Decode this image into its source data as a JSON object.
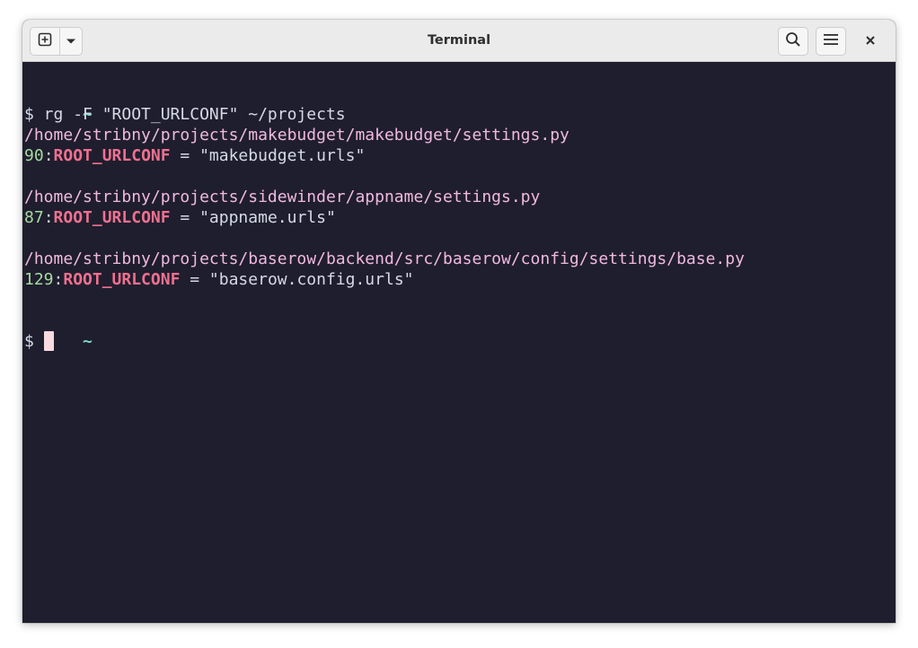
{
  "window": {
    "title": "Terminal"
  },
  "header": {
    "new_tab_icon": "new-tab-icon",
    "dropdown_icon": "chevron-down-icon",
    "search_icon": "search-icon",
    "menu_icon": "hamburger-menu-icon",
    "close_icon": "close-icon"
  },
  "terminal": {
    "prompt_dir_1": "~",
    "prompt_symbol_1": "$",
    "command": " rg -F \"ROOT_URLCONF\" ~/projects",
    "results": [
      {
        "path": "/home/stribny/projects/makebudget/makebudget/settings.py",
        "line_number": "90",
        "separator": ":",
        "match": "ROOT_URLCONF",
        "rest": " = \"makebudget.urls\""
      },
      {
        "path": "/home/stribny/projects/sidewinder/appname/settings.py",
        "line_number": "87",
        "separator": ":",
        "match": "ROOT_URLCONF",
        "rest": " = \"appname.urls\""
      },
      {
        "path": "/home/stribny/projects/baserow/backend/src/baserow/config/settings/base.py",
        "line_number": "129",
        "separator": ":",
        "match": "ROOT_URLCONF",
        "rest": " = \"baserow.config.urls\""
      }
    ],
    "prompt_dir_2": "~",
    "prompt_symbol_2": "$ "
  },
  "colors": {
    "background": "#1f1e2e",
    "foreground": "#d7d9e6",
    "path": "#f0b9de",
    "line_number": "#a6dba0",
    "match": "#f0708f",
    "prompt_dir": "#7fd6c7",
    "cursor": "#f9dadf",
    "titlebar": "#ebebeb"
  }
}
